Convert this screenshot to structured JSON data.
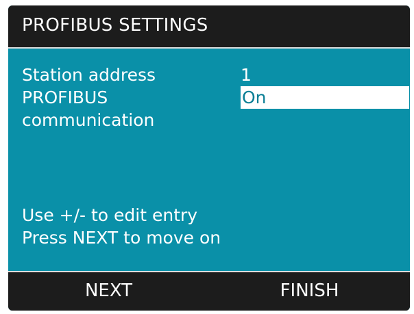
{
  "header": {
    "title": "PROFIBUS SETTINGS"
  },
  "settings": [
    {
      "label": "Station address",
      "value": "1"
    },
    {
      "label": "PROFIBUS",
      "label_line2": "communication",
      "value": "On"
    }
  ],
  "hints": [
    "Use +/- to edit entry",
    "Press NEXT to move on"
  ],
  "softkeys": {
    "left": "NEXT",
    "right": "FINISH"
  },
  "colors": {
    "screen_bg": "#0a90a8",
    "bar_bg": "#1c1c1c",
    "text": "#ffffff",
    "selected_bg": "#ffffff"
  }
}
